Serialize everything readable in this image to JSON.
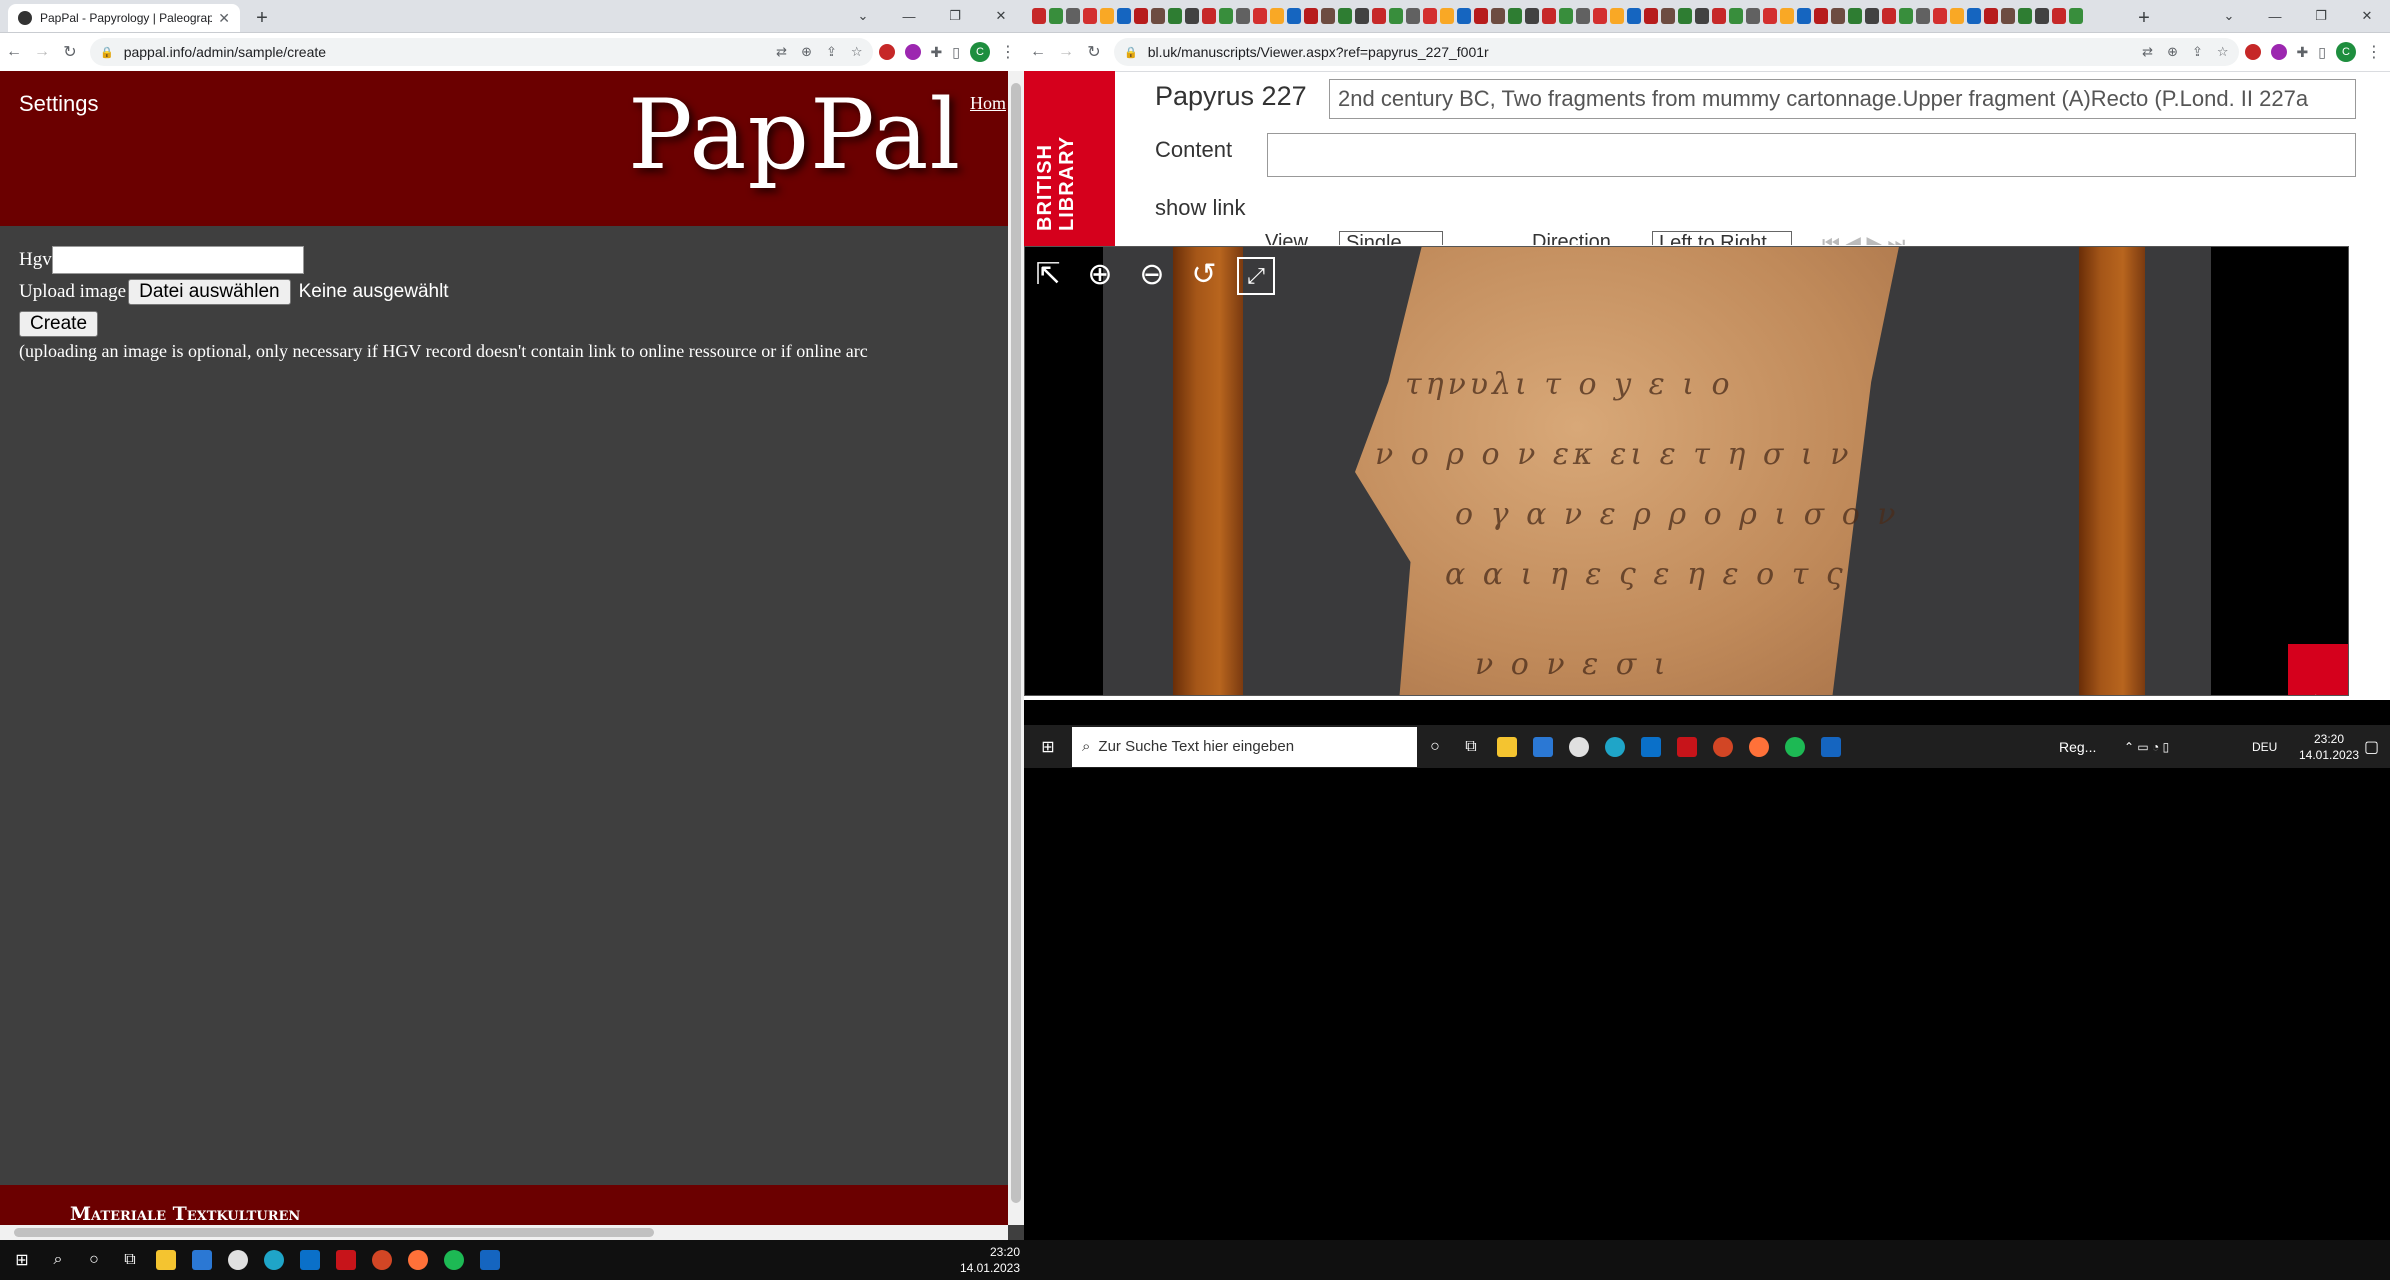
{
  "left_browser": {
    "tab_title": "PapPal - Papyrology | Paleograph",
    "url": "pappal.info/admin/sample/create"
  },
  "pappal": {
    "settings": "Settings",
    "logo": "PapPal",
    "home_link": "Hom",
    "hgv_label": "Hgv",
    "upload_label": "Upload image",
    "choose_file_button": "Datei auswählen",
    "no_file": "Keine ausgewählt",
    "create_button": "Create",
    "note": "(uploading an image is optional, only necessary if HGV record doesn't contain link to online ressource or if online arc",
    "footer": "Materiale Textkulturen"
  },
  "right_browser": {
    "url": "bl.uk/manuscripts/Viewer.aspx?ref=papyrus_227_f001r"
  },
  "viewer": {
    "logo": "BRITISH LIBRARY",
    "title": "Papyrus 227",
    "description": "2nd century BC, Two fragments from mummy cartonnage.Upper fragment (A)Recto (P.Lond. II 227a",
    "content_label": "Content",
    "show_link": "show link",
    "view_label": "View",
    "view_value": "Single",
    "direction_label": "Direction",
    "direction_value": "Left to Right",
    "tools": [
      "exit-icon",
      "zoom-in-icon",
      "zoom-out-icon",
      "rotate-icon",
      "fullscreen-icon"
    ]
  },
  "inner_taskbar": {
    "search_placeholder": "Zur Suche Text hier eingeben",
    "weather": "Reg...",
    "lang": "DEU",
    "time": "23:20",
    "date": "14.01.2023"
  },
  "taskbar": {
    "time": "23:20",
    "date": "14.01.2023"
  }
}
